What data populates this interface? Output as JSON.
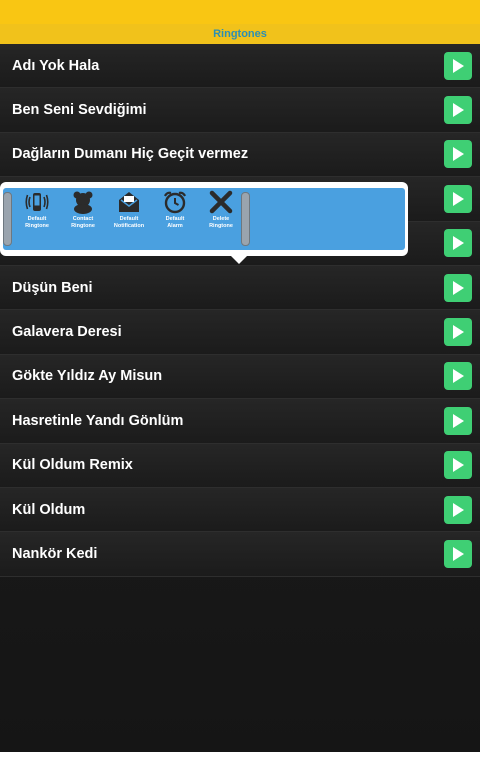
{
  "app": {
    "title": "Ringtones"
  },
  "ringtones": [
    "Adı Yok Hala",
    "Ben Seni Sevdiğimi",
    "Dağların Dumanı Hiç Geçit vermez",
    "",
    "",
    "Düşün Beni",
    "Galavera Deresi",
    "Gökte Yıldız Ay Misun",
    "Hasretinle Yandı Gönlüm",
    "Kül Oldum Remix",
    "Kül Oldum",
    "Nankör Kedi"
  ],
  "popup": {
    "actions": [
      {
        "line1": "Default",
        "line2": "Ringtone",
        "icon": "phone-ringing-icon"
      },
      {
        "line1": "Contact",
        "line2": "Ringtone",
        "icon": "contact-bear-icon"
      },
      {
        "line1": "Default",
        "line2": "Notification",
        "icon": "envelope-icon"
      },
      {
        "line1": "Default",
        "line2": "Alarm",
        "icon": "alarm-clock-icon"
      },
      {
        "line1": "Delete",
        "line2": "Ringtone",
        "icon": "delete-x-icon"
      }
    ]
  },
  "colors": {
    "statusBar": "#f9c613",
    "titleText": "#2d8fb3",
    "play": "#3fcf74",
    "popup": "#4aa0e0"
  }
}
